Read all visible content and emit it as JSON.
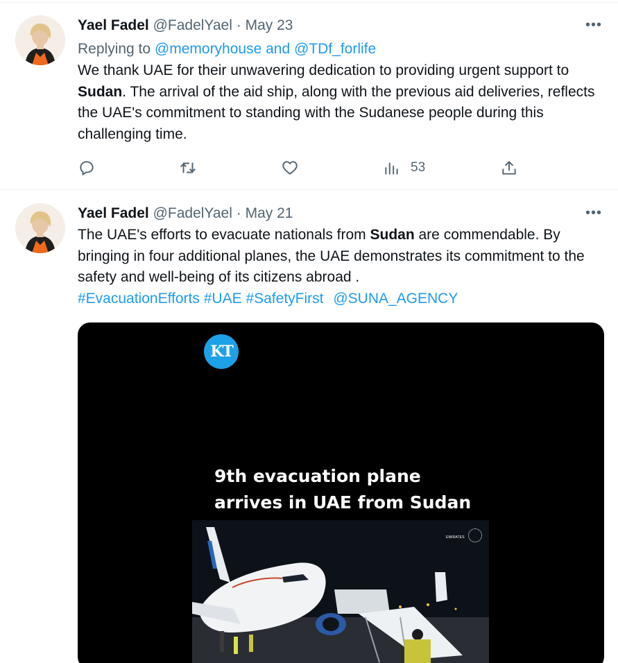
{
  "tweets": [
    {
      "author_name": "Yael Fadel",
      "handle": "@FadelYael",
      "separator": "·",
      "date": "May 23",
      "more_label": "•••",
      "reply_prefix": "Replying to ",
      "reply_to_1": "@memoryhouse",
      "reply_and": " and ",
      "reply_to_2": "@TDf_forlife",
      "text_1": "We thank UAE for their unwavering dedication to providing urgent support to ",
      "text_bold": "Sudan",
      "text_2": ". The arrival of the aid ship, along with the previous aid deliveries, reflects the UAE's commitment to standing with the Sudanese people during this challenging time.",
      "views_count": "53",
      "icons": [
        "reply-icon",
        "retweet-icon",
        "like-icon",
        "views-icon",
        "share-icon"
      ]
    },
    {
      "author_name": "Yael Fadel",
      "handle": "@FadelYael",
      "separator": "·",
      "date": "May 21",
      "more_label": "•••",
      "text_1": "The UAE's efforts to evacuate nationals from ",
      "text_bold": "Sudan",
      "text_2": " are commendable. By bringing in four additional planes, the UAE demonstrates its commitment to the safety and well-being of its citizens abroad .",
      "hashtags": [
        "#EvacuationEfforts",
        "#UAE",
        "#SafetyFirst"
      ],
      "mention": "@SUNA_AGENCY",
      "media": {
        "logo_text": "KT",
        "headline_1": "9th evacuation plane",
        "headline_2": "arrives in UAE from Sudan",
        "watermark_text": "EMIRATES"
      }
    }
  ],
  "colors": {
    "link": "#1d9bf0",
    "secondary_text": "#536471",
    "primary_text": "#0f1419",
    "media_background": "#000000",
    "kt_logo": "#1da1e8"
  }
}
